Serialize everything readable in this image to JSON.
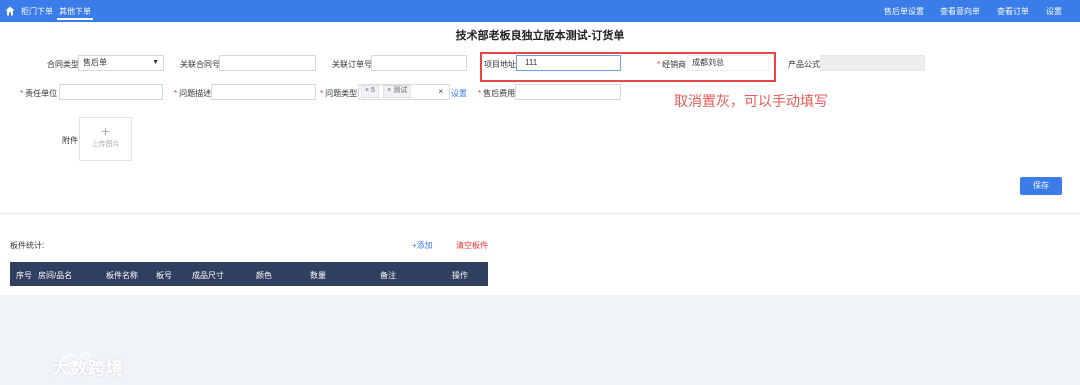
{
  "topbar": {
    "tabs": [
      "柜门下单",
      "其他下单"
    ],
    "right_links": [
      "售后单设置",
      "查看意向单",
      "查看订单",
      "设置"
    ]
  },
  "form": {
    "title": "技术部老板良独立版本测试-订货单",
    "contract_type": {
      "label": "合同类型",
      "value": "售后单"
    },
    "linked_contract": {
      "label": "关联合同号",
      "value": ""
    },
    "linked_order": {
      "label": "关联订单号",
      "value": ""
    },
    "project_address": {
      "label": "项目地址",
      "value": "111"
    },
    "dealer": {
      "label": "经销商",
      "value": "成都刘总"
    },
    "product_formula": {
      "label": "产品公式",
      "value": ""
    },
    "responsible_unit": {
      "label": "责任单位",
      "value": ""
    },
    "problem_desc": {
      "label": "问题描述",
      "value": ""
    },
    "problem_type": {
      "label": "问题类型",
      "tags": [
        "5",
        "测试"
      ],
      "clear": "×"
    },
    "settings_link": "设置",
    "after_sales_fee": {
      "label": "售后费用",
      "value": ""
    },
    "attachment": {
      "label": "附件",
      "upload_text": "上传图片",
      "plus": "+"
    },
    "save_label": "保存",
    "required_mark": "*"
  },
  "annotation": {
    "text": "取消置灰，可以手动填写",
    "color": "#e94545"
  },
  "panel": {
    "stats_label": "板件统计:",
    "add_label": "+添加",
    "clear_label": "清空板件",
    "columns": [
      "序号",
      "房间/品名",
      "板件名称",
      "板号",
      "成品尺寸",
      "颜色",
      "数量",
      "备注",
      "操作"
    ]
  },
  "watermark": {
    "text": "大数跨境"
  },
  "colors": {
    "primary": "#3a7de8",
    "header_dark": "#2f3f5f",
    "required": "#e33333"
  }
}
